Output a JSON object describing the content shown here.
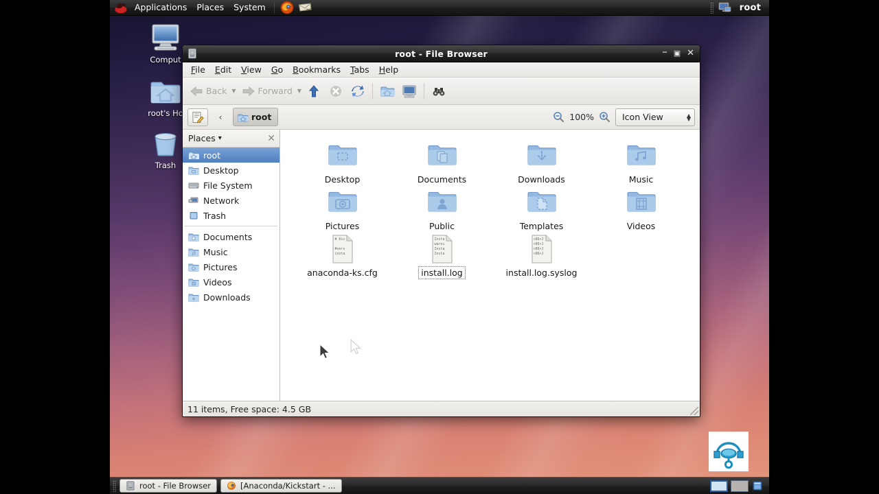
{
  "panel": {
    "logo_icon": "redhat-logo-icon",
    "menus": [
      {
        "label": "Applications",
        "name": "applications-menu"
      },
      {
        "label": "Places",
        "name": "places-menu"
      },
      {
        "label": "System",
        "name": "system-menu"
      }
    ],
    "launchers": [
      {
        "name": "firefox-launcher-icon",
        "title": "Firefox Web Browser"
      },
      {
        "name": "email-launcher-icon",
        "title": "Evolution Mail"
      }
    ],
    "tray": {
      "display_icon": "display-settings-icon",
      "user": "root"
    }
  },
  "desktop": {
    "icons": [
      {
        "label": "Comput",
        "name": "desktop-icon-computer",
        "icon": "computer-icon"
      },
      {
        "label": "root's Ho",
        "name": "desktop-icon-home",
        "icon": "home-folder-icon"
      },
      {
        "label": "Trash",
        "name": "desktop-icon-trash",
        "icon": "trash-icon"
      }
    ]
  },
  "window": {
    "title": "root - File Browser",
    "titlebar_icon": "file-browser-icon",
    "buttons": {
      "minimize": "–",
      "maximize": "▣",
      "close": "✕"
    },
    "menubar": [
      {
        "label": "File",
        "accel": "F",
        "name": "menu-file"
      },
      {
        "label": "Edit",
        "accel": "E",
        "name": "menu-edit"
      },
      {
        "label": "View",
        "accel": "V",
        "name": "menu-view"
      },
      {
        "label": "Go",
        "accel": "G",
        "name": "menu-go"
      },
      {
        "label": "Bookmarks",
        "accel": "B",
        "name": "menu-bookmarks"
      },
      {
        "label": "Tabs",
        "accel": "T",
        "name": "menu-tabs"
      },
      {
        "label": "Help",
        "accel": "H",
        "name": "menu-help"
      }
    ],
    "toolbar": {
      "back_label": "Back",
      "forward_label": "Forward",
      "up_icon": "up-arrow-icon",
      "stop_icon": "stop-icon",
      "reload_icon": "reload-icon",
      "home_icon": "home-icon",
      "computer_icon": "computer-icon",
      "search_icon": "search-binoculars-icon"
    },
    "locationbar": {
      "edit_location_icon": "edit-location-icon",
      "prev_crumb_label": "‹",
      "crumb_label": "root",
      "crumb_icon": "home-folder-icon",
      "zoom_out_icon": "zoom-out-icon",
      "zoom_level": "100%",
      "zoom_in_icon": "zoom-in-icon",
      "view_mode": "Icon View"
    },
    "sidebar": {
      "header": "Places",
      "header_caret": "⌄",
      "close_icon": "close-icon",
      "group1": [
        {
          "label": "root",
          "icon": "home-folder-icon",
          "name": "place-root",
          "selected": true
        },
        {
          "label": "Desktop",
          "icon": "desktop-folder-icon",
          "name": "place-desktop",
          "selected": false
        },
        {
          "label": "File System",
          "icon": "drive-icon",
          "name": "place-file-system",
          "selected": false
        },
        {
          "label": "Network",
          "icon": "network-icon",
          "name": "place-network",
          "selected": false
        },
        {
          "label": "Trash",
          "icon": "trash-icon",
          "name": "place-trash",
          "selected": false
        }
      ],
      "group2": [
        {
          "label": "Documents",
          "icon": "documents-folder-icon",
          "name": "place-documents"
        },
        {
          "label": "Music",
          "icon": "music-folder-icon",
          "name": "place-music"
        },
        {
          "label": "Pictures",
          "icon": "pictures-folder-icon",
          "name": "place-pictures"
        },
        {
          "label": "Videos",
          "icon": "videos-folder-icon",
          "name": "place-videos"
        },
        {
          "label": "Downloads",
          "icon": "downloads-folder-icon",
          "name": "place-downloads"
        }
      ]
    },
    "files": [
      {
        "label": "Desktop",
        "kind": "folder",
        "icon": "desktop-folder-icon",
        "focused": false
      },
      {
        "label": "Documents",
        "kind": "folder",
        "icon": "documents-folder-icon",
        "focused": false
      },
      {
        "label": "Downloads",
        "kind": "folder",
        "icon": "downloads-folder-icon",
        "focused": false
      },
      {
        "label": "Music",
        "kind": "folder",
        "icon": "music-folder-icon",
        "focused": false
      },
      {
        "label": "Pictures",
        "kind": "folder",
        "icon": "pictures-folder-icon",
        "focused": false
      },
      {
        "label": "Public",
        "kind": "folder",
        "icon": "public-folder-icon",
        "focused": false
      },
      {
        "label": "Templates",
        "kind": "folder",
        "icon": "templates-folder-icon",
        "focused": false
      },
      {
        "label": "Videos",
        "kind": "folder",
        "icon": "videos-folder-icon",
        "focused": false
      },
      {
        "label": "anaconda-ks.cfg",
        "kind": "text",
        "icon": "text-file-icon",
        "focused": false,
        "preview": [
          "# Kic",
          "",
          "#vers",
          "insta"
        ]
      },
      {
        "label": "install.log",
        "kind": "text",
        "icon": "text-file-icon",
        "focused": true,
        "preview": [
          "Insta",
          "warni",
          "Insta",
          "Insta"
        ]
      },
      {
        "label": "install.log.syslog",
        "kind": "text",
        "icon": "text-file-icon",
        "focused": false,
        "preview": [
          "<86>J",
          "<86>J",
          "<86>J",
          "<86>J"
        ]
      }
    ],
    "statusbar": "11 items, Free space: 4.5 GB"
  },
  "taskbar": {
    "tasks": [
      {
        "label": "root - File Browser",
        "icon": "file-browser-icon",
        "name": "task-file-browser"
      },
      {
        "label": "[Anaconda/Kickstart - ...",
        "icon": "firefox-icon",
        "name": "task-firefox"
      }
    ],
    "workspaces": [
      {
        "name": "workspace-1",
        "active": true
      },
      {
        "name": "workspace-2",
        "active": false
      }
    ],
    "trash_applet_icon": "trash-applet-icon"
  },
  "overlay": {
    "vnc_icon": "vnc-headset-icon"
  },
  "colors": {
    "selection_blue": "#4f7fc0",
    "panel_dark": "#1f1f1f",
    "folder_blue": "#9cbde2",
    "accent_red": "#8c3a3a"
  }
}
